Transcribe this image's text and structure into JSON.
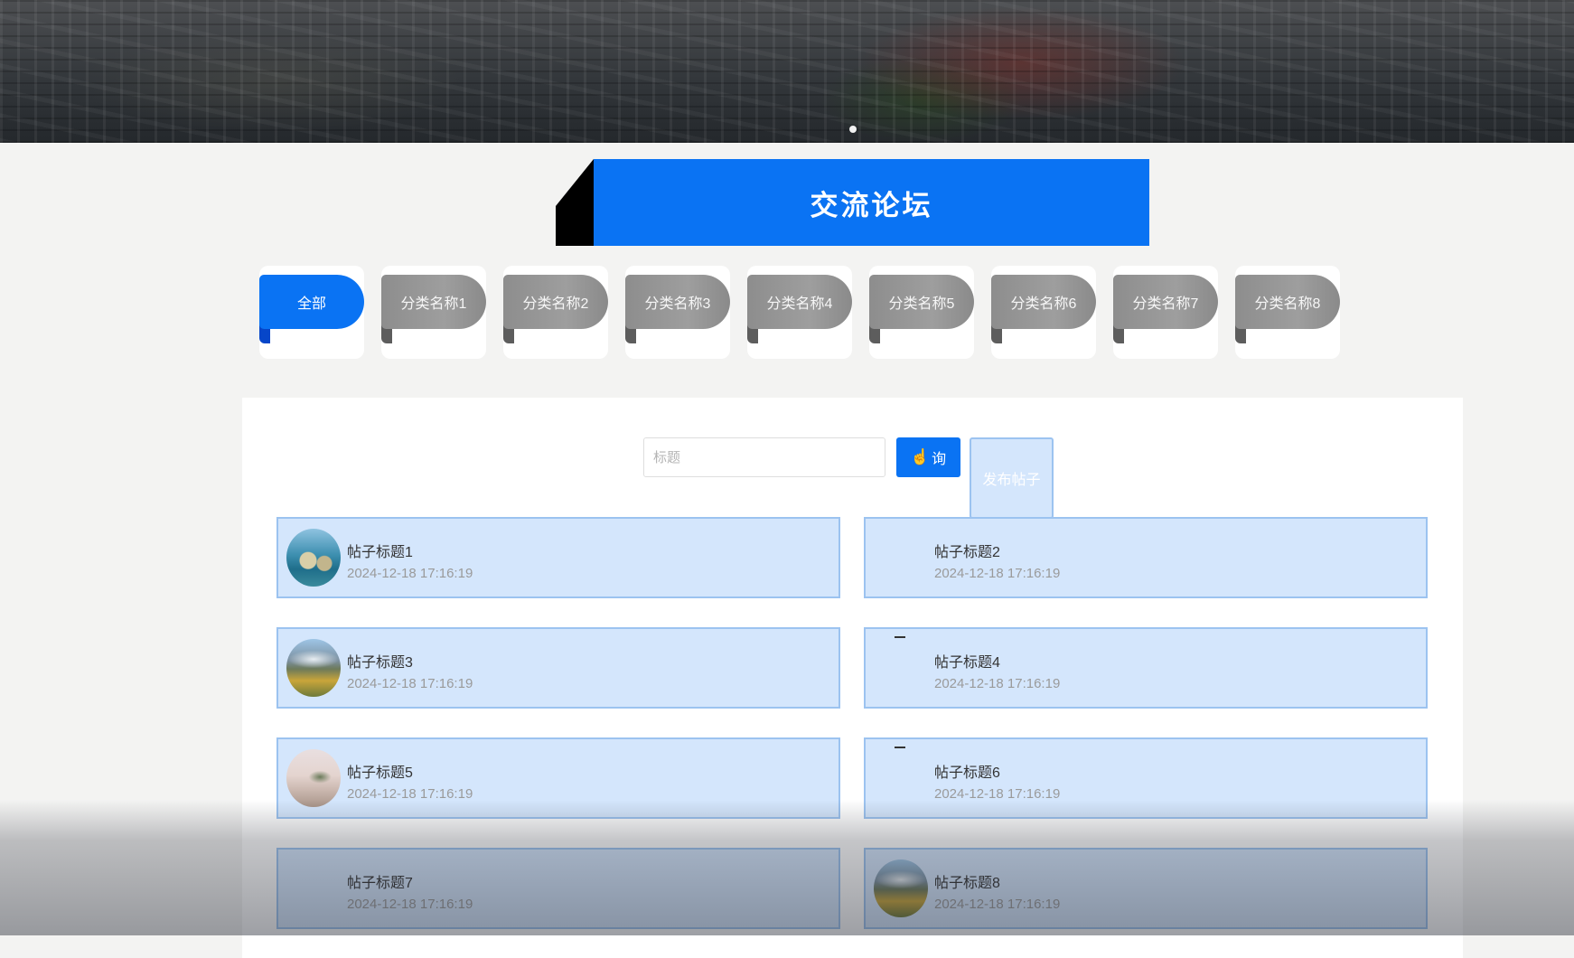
{
  "banner": {
    "carousel_dots": 1
  },
  "section_title": "交流论坛",
  "categories": [
    {
      "label": "全部",
      "active": true
    },
    {
      "label": "分类名称1",
      "active": false
    },
    {
      "label": "分类名称2",
      "active": false
    },
    {
      "label": "分类名称3",
      "active": false
    },
    {
      "label": "分类名称4",
      "active": false
    },
    {
      "label": "分类名称5",
      "active": false
    },
    {
      "label": "分类名称6",
      "active": false
    },
    {
      "label": "分类名称7",
      "active": false
    },
    {
      "label": "分类名称8",
      "active": false
    }
  ],
  "search": {
    "placeholder": "标题",
    "value": "",
    "search_label": "查询",
    "search_label_visible": "询",
    "post_label": "发布帖子"
  },
  "posts": [
    {
      "title": "帖子标题1",
      "time": "2024-12-18 17:16:19",
      "avatar": "coastal-rocks-image"
    },
    {
      "title": "帖子标题2",
      "time": "2024-12-18 17:16:19",
      "avatar": ""
    },
    {
      "title": "帖子标题3",
      "time": "2024-12-18 17:16:19",
      "avatar": "mountain-meadow-image"
    },
    {
      "title": "帖子标题4",
      "time": "2024-12-18 17:16:19",
      "avatar": ""
    },
    {
      "title": "帖子标题5",
      "time": "2024-12-18 17:16:19",
      "avatar": "misty-pine-image"
    },
    {
      "title": "帖子标题6",
      "time": "2024-12-18 17:16:19",
      "avatar": ""
    },
    {
      "title": "帖子标题7",
      "time": "2024-12-18 17:16:19",
      "avatar": ""
    },
    {
      "title": "帖子标题8",
      "time": "2024-12-18 17:16:19",
      "avatar": "mountain-meadow-image"
    }
  ],
  "colors": {
    "accent": "#0a73f3",
    "tab_inactive": "#9a9a9a",
    "post_bg": "#d4e6fc",
    "post_border": "#9cc3f0"
  }
}
